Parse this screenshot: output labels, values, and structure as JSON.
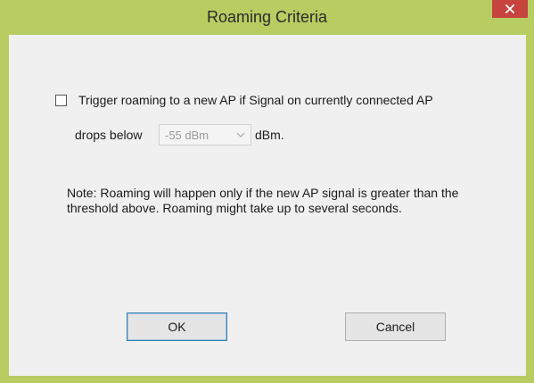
{
  "window": {
    "title": "Roaming Criteria",
    "close_icon": "close-icon",
    "colors": {
      "frame": "#b7cd62",
      "close": "#c7433d",
      "client": "#f0f0f0",
      "default_button_border": "#3c7fb1"
    }
  },
  "trigger": {
    "checked": false,
    "line1": "Trigger roaming to a new AP if Signal on currently connected AP",
    "drops_below_label": "drops below",
    "threshold_value": "-55 dBm",
    "unit_label": "dBm.",
    "dropdown_icon": "chevron-down-icon"
  },
  "note": {
    "text": "Note: Roaming will happen only if the new AP signal is greater than the threshold above. Roaming might take up to several seconds."
  },
  "buttons": {
    "ok": "OK",
    "cancel": "Cancel"
  }
}
